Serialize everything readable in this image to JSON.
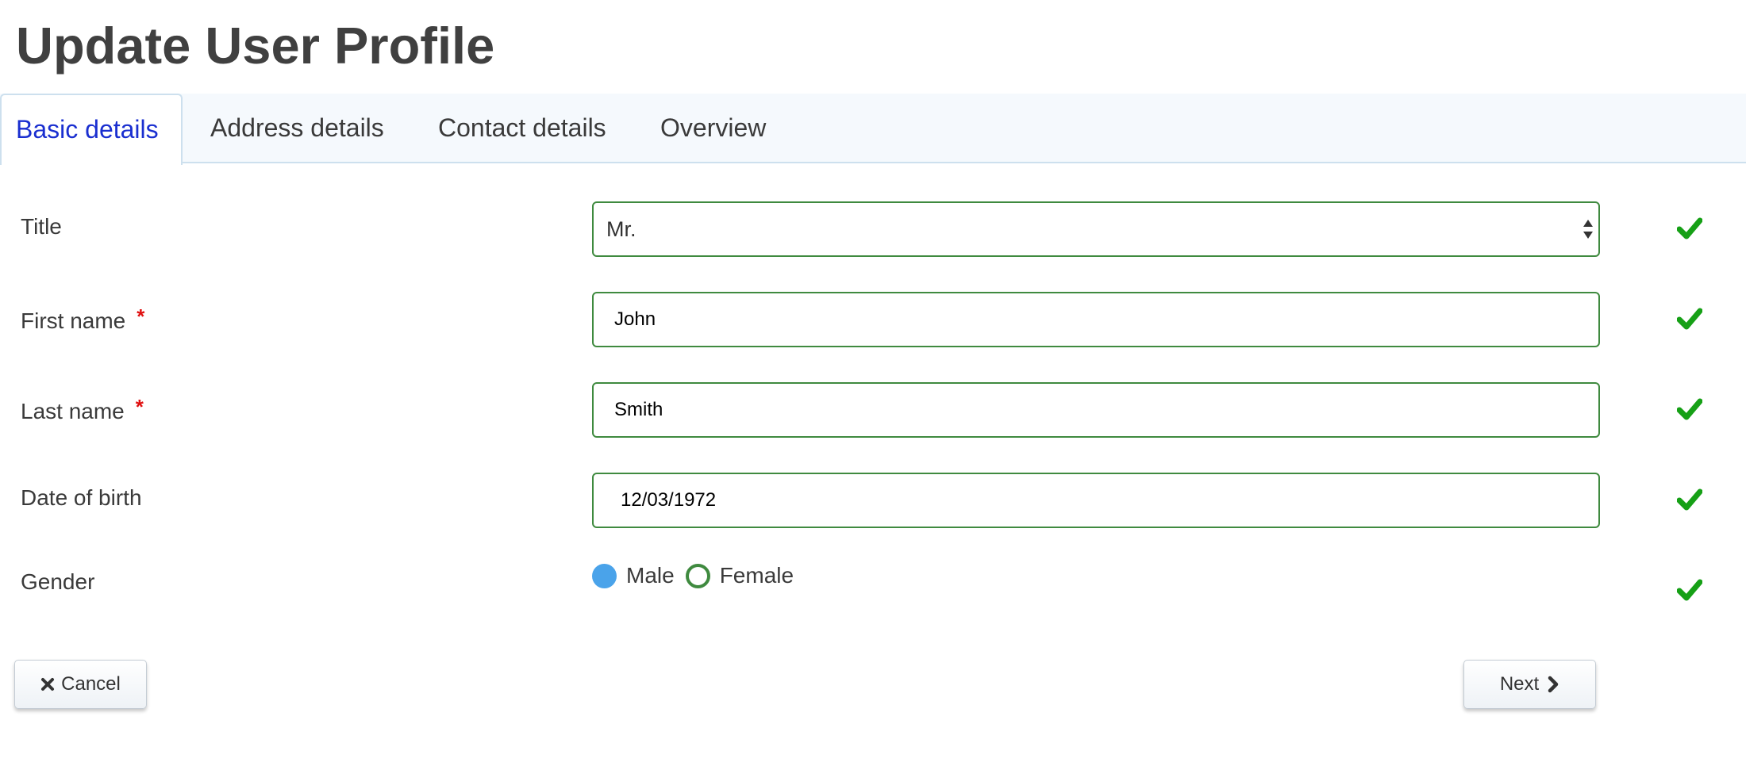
{
  "page": {
    "title": "Update User Profile"
  },
  "tabs": [
    {
      "label": "Basic details",
      "active": true
    },
    {
      "label": "Address details",
      "active": false
    },
    {
      "label": "Contact details",
      "active": false
    },
    {
      "label": "Overview",
      "active": false
    }
  ],
  "form": {
    "title_field": {
      "label": "Title",
      "value": "Mr.",
      "required": false,
      "valid": true
    },
    "first_name": {
      "label": "First name",
      "value": "John",
      "required": true,
      "required_mark": "*",
      "valid": true
    },
    "last_name": {
      "label": "Last name",
      "value": "Smith",
      "required": true,
      "required_mark": "*",
      "valid": true
    },
    "date_of_birth": {
      "label": "Date of birth",
      "value": "12/03/1972",
      "required": false,
      "valid": true
    },
    "gender": {
      "label": "Gender",
      "options": [
        {
          "label": "Male",
          "checked": true
        },
        {
          "label": "Female",
          "checked": false
        }
      ],
      "valid": true
    }
  },
  "buttons": {
    "cancel_label": "Cancel",
    "next_label": "Next"
  },
  "icons": {
    "valid": "check-icon",
    "cancel": "x-icon",
    "next": "chevron-right-icon",
    "select": "select-arrows-icon"
  },
  "colors": {
    "title": "#404040",
    "active_tab": "#1a2fd0",
    "tab_bar_bg": "#f5f9fd",
    "valid_border": "#3f8a3f",
    "check": "#16a016",
    "required": "#e01010",
    "radio_checked": "#4aa3ea"
  }
}
